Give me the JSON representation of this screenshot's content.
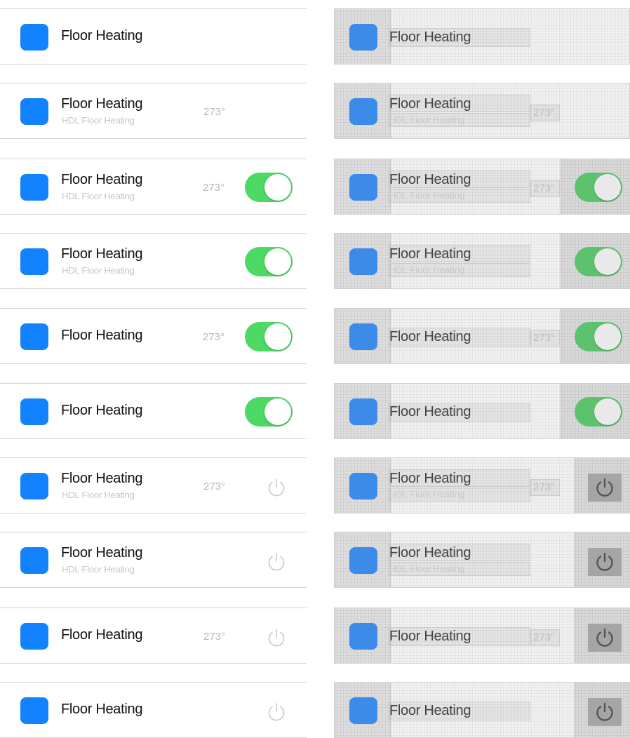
{
  "colors": {
    "tile_blue": "#1282ff",
    "toggle_on": "#4cd964",
    "secondary_text": "#c6c6c6",
    "value_text": "#b8b8b8"
  },
  "rows": [
    {
      "title": "Floor Heating",
      "subtitle": "",
      "value": "",
      "control": "none"
    },
    {
      "title": "Floor Heating",
      "subtitle": "HDL Floor Heating",
      "value": "273°",
      "control": "none"
    },
    {
      "title": "Floor Heating",
      "subtitle": "HDL Floor Heating",
      "value": "273°",
      "control": "toggle",
      "toggle_on": true
    },
    {
      "title": "Floor Heating",
      "subtitle": "HDL Floor Heating",
      "value": "",
      "control": "toggle",
      "toggle_on": true
    },
    {
      "title": "Floor Heating",
      "subtitle": "",
      "value": "273°",
      "control": "toggle",
      "toggle_on": true
    },
    {
      "title": "Floor Heating",
      "subtitle": "",
      "value": "",
      "control": "toggle",
      "toggle_on": true
    },
    {
      "title": "Floor Heating",
      "subtitle": "HDL Floor Heating",
      "value": "273°",
      "control": "power",
      "icon": "power-icon"
    },
    {
      "title": "Floor Heating",
      "subtitle": "HDL Floor Heating",
      "value": "",
      "control": "power",
      "icon": "power-icon"
    },
    {
      "title": "Floor Heating",
      "subtitle": "",
      "value": "273°",
      "control": "power",
      "icon": "power-icon"
    },
    {
      "title": "Floor Heating",
      "subtitle": "",
      "value": "",
      "control": "power",
      "icon": "power-icon"
    }
  ]
}
